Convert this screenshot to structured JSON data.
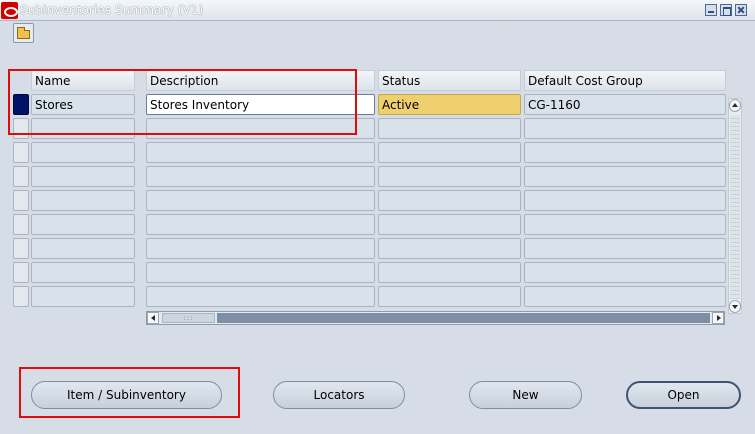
{
  "window": {
    "title": "Subinventories Summary (V1)"
  },
  "toolbar": {
    "open_tooltip_icon": "open-folder-icon"
  },
  "table": {
    "columns": [
      "Name",
      "Description",
      "Status",
      "Default Cost Group"
    ],
    "rows": [
      {
        "name": "Stores",
        "description": "Stores Inventory",
        "status": "Active",
        "cost_group": "CG-1160"
      }
    ],
    "empty_rows": 8
  },
  "buttons": {
    "item_subinventory": "Item / Subinventory",
    "locators": "Locators",
    "new": "New",
    "open": "Open"
  },
  "colors": {
    "status_active_bg": "#f0d06e",
    "current_record_indicator": "#001266",
    "annotation": "#e10b0b"
  }
}
